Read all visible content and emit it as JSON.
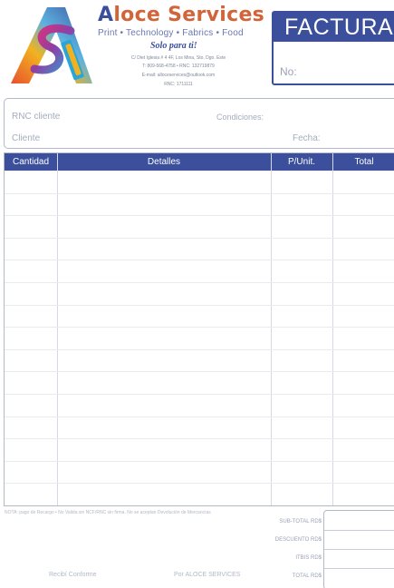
{
  "company": {
    "name_first": "A",
    "name_rest": "loce Services",
    "tagline": "Print • Technology • Fabrics • Food",
    "slogan": "Solo para ti!",
    "info_lines": [
      "C/ Diet Iglesia # 4 4F, Los Mina, Sto. Dgo. Este",
      "T: 809-568-4758 • RNC: 132719879",
      "E-mail: alloceservices@outlook.com",
      "RNC: 1711111"
    ]
  },
  "invoice": {
    "title": "FACTURA",
    "number_label": "No:"
  },
  "client_fields": {
    "rnc_label": "RNC cliente",
    "conditions_label": "Condiciones:",
    "client_label": "Cliente",
    "date_label": "Fecha:"
  },
  "table": {
    "headers": [
      "Cantidad",
      "Detalles",
      "P/Unit.",
      "Total"
    ],
    "row_count": 15
  },
  "footer": {
    "note": "NOTA: pago de Recargo • No Valida sin NCF/RNC sin firma. No se aceptan Devolución de Mercancías",
    "totals_labels": [
      "SUB-TOTAL RD$",
      "DESCUENTO RD$",
      "ITBIS RD$",
      "TOTAL RD$"
    ],
    "signature_client": "Recibí Conforme",
    "signature_company": "Por ALOCE SERVICES"
  },
  "colors": {
    "primary": "#3b4f9c",
    "accent": "#d2643a"
  }
}
